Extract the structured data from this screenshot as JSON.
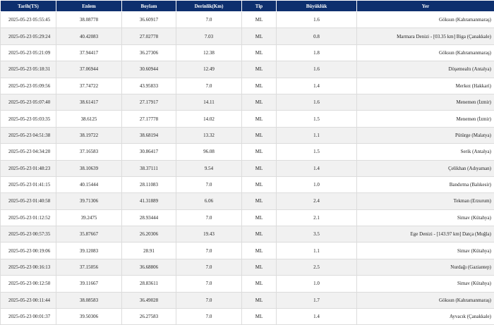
{
  "columns": [
    "Tarih(TS)",
    "Enlem",
    "Boylam",
    "Derinlik(Km)",
    "Tip",
    "Büyüklük",
    "Yer"
  ],
  "rows": [
    {
      "date": "2025-05-23 05:55:45",
      "lat": "38.08778",
      "lon": "36.60917",
      "depth": "7.0",
      "type": "ML",
      "mag": "1.6",
      "place": "Göksun (Kahramanmaraş)"
    },
    {
      "date": "2025-05-23 05:29:24",
      "lat": "40.42083",
      "lon": "27.02778",
      "depth": "7.03",
      "type": "ML",
      "mag": "0.8",
      "place": "Marmara Denizi - [03.35 km] Biga (Çanakkale)"
    },
    {
      "date": "2025-05-23 05:21:09",
      "lat": "37.94417",
      "lon": "36.27306",
      "depth": "12.38",
      "type": "ML",
      "mag": "1.8",
      "place": "Göksun (Kahramanmaraş)"
    },
    {
      "date": "2025-05-23 05:18:31",
      "lat": "37.06944",
      "lon": "30.60944",
      "depth": "12.49",
      "type": "ML",
      "mag": "1.6",
      "place": "Döşemealtı (Antalya)"
    },
    {
      "date": "2025-05-23 05:09:56",
      "lat": "37.74722",
      "lon": "43.95833",
      "depth": "7.0",
      "type": "ML",
      "mag": "1.4",
      "place": "Merkez (Hakkari)"
    },
    {
      "date": "2025-05-23 05:07:40",
      "lat": "38.61417",
      "lon": "27.17917",
      "depth": "14.11",
      "type": "ML",
      "mag": "1.6",
      "place": "Menemen (İzmir)"
    },
    {
      "date": "2025-05-23 05:03:35",
      "lat": "38.6125",
      "lon": "27.17778",
      "depth": "14.02",
      "type": "ML",
      "mag": "1.5",
      "place": "Menemen (İzmir)"
    },
    {
      "date": "2025-05-23 04:51:38",
      "lat": "38.19722",
      "lon": "38.68194",
      "depth": "13.32",
      "type": "ML",
      "mag": "1.1",
      "place": "Pütürge (Malatya)"
    },
    {
      "date": "2025-05-23 04:34:20",
      "lat": "37.16583",
      "lon": "30.86417",
      "depth": "96.08",
      "type": "ML",
      "mag": "1.5",
      "place": "Serik (Antalya)"
    },
    {
      "date": "2025-05-23 01:48:23",
      "lat": "38.10639",
      "lon": "38.37111",
      "depth": "9.54",
      "type": "ML",
      "mag": "1.4",
      "place": "Çelikhan (Adıyaman)"
    },
    {
      "date": "2025-05-23 01:41:15",
      "lat": "40.15444",
      "lon": "28.11083",
      "depth": "7.0",
      "type": "ML",
      "mag": "1.0",
      "place": "Bandırma (Balıkesir)"
    },
    {
      "date": "2025-05-23 01:40:58",
      "lat": "39.71306",
      "lon": "41.31889",
      "depth": "6.06",
      "type": "ML",
      "mag": "2.4",
      "place": "Tekman (Erzurum)"
    },
    {
      "date": "2025-05-23 01:12:52",
      "lat": "39.2475",
      "lon": "28.93444",
      "depth": "7.0",
      "type": "ML",
      "mag": "2.1",
      "place": "Simav (Kütahya)"
    },
    {
      "date": "2025-05-23 00:57:35",
      "lat": "35.87667",
      "lon": "26.20306",
      "depth": "19.43",
      "type": "ML",
      "mag": "3.5",
      "place": "Ege Denizi - [143.97 km] Datça (Muğla)"
    },
    {
      "date": "2025-05-23 00:19:06",
      "lat": "39.12083",
      "lon": "28.91",
      "depth": "7.0",
      "type": "ML",
      "mag": "1.1",
      "place": "Simav (Kütahya)"
    },
    {
      "date": "2025-05-23 00:16:13",
      "lat": "37.15056",
      "lon": "36.68806",
      "depth": "7.0",
      "type": "ML",
      "mag": "2.5",
      "place": "Nurdağı (Gaziantep)"
    },
    {
      "date": "2025-05-23 00:12:50",
      "lat": "39.11667",
      "lon": "28.83611",
      "depth": "7.0",
      "type": "ML",
      "mag": "1.0",
      "place": "Simav (Kütahya)"
    },
    {
      "date": "2025-05-23 00:11:44",
      "lat": "38.08583",
      "lon": "36.49028",
      "depth": "7.0",
      "type": "ML",
      "mag": "1.7",
      "place": "Göksun (Kahramanmaraş)"
    },
    {
      "date": "2025-05-23 00:01:37",
      "lat": "39.50306",
      "lon": "26.27583",
      "depth": "7.0",
      "type": "ML",
      "mag": "1.4",
      "place": "Ayvacık (Çanakkale)"
    }
  ]
}
